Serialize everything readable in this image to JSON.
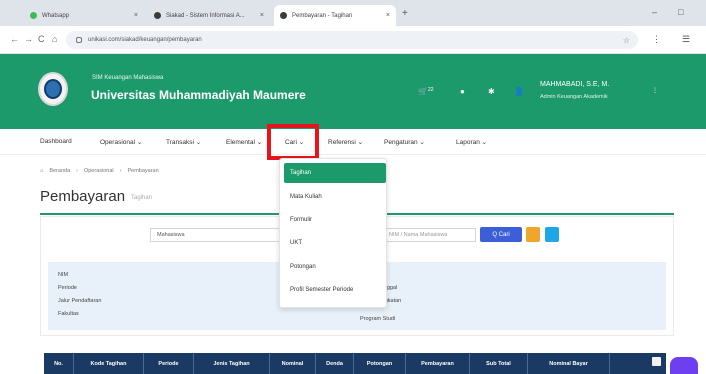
{
  "browser": {
    "tabs": [
      {
        "label": "Whatsapp",
        "close": "×",
        "favicon_color": "#3cbc5a"
      },
      {
        "label": "Siakad - Sistem Informasi A...",
        "close": "×",
        "favicon_color": "#3a3a3a"
      },
      {
        "label": "Pembayaran - Tagihan",
        "close": "×",
        "favicon_color": "#3a3a3a"
      }
    ],
    "new_tab": "+",
    "window_controls": [
      "–",
      "□"
    ],
    "nav": {
      "back": "←",
      "forward": "→",
      "reload": "C",
      "home": "⌂"
    },
    "url": "unikasi.com/siakad/keuangan/pembayaran",
    "omni_right": [
      "☆",
      "⋮"
    ],
    "extensions": [
      "⋮",
      "☰"
    ]
  },
  "header": {
    "subtitle": "SIM Keuangan Mahasiswa",
    "title": "Universitas Muhammadiyah Maumere",
    "icons": {
      "cart": "🛒",
      "cart_badge": "22",
      "bell": "●",
      "settings": "✱",
      "person": "👤"
    },
    "user": {
      "name": "MAHMABADI, S.E, M.",
      "role": "Admin Keuangan Akademik",
      "caret": "⋮"
    }
  },
  "nav": {
    "items": [
      {
        "label": "Dashboard"
      },
      {
        "label": "Operasional ⌄"
      },
      {
        "label": "Transaksi ⌄"
      },
      {
        "label": "Elemental ⌄"
      },
      {
        "label": "Cari ⌄"
      },
      {
        "label": "Referensi ⌄"
      },
      {
        "label": "Pengaturan ⌄"
      },
      {
        "label": "Laporan ⌄"
      }
    ]
  },
  "dropdown": {
    "items": [
      {
        "label": "Tagihan",
        "active": true
      },
      {
        "label": "Mata Kuliah"
      },
      {
        "label": "Formulir"
      },
      {
        "label": "UKT"
      },
      {
        "label": "Potongan"
      },
      {
        "label": "Profil Semester Periode"
      }
    ]
  },
  "breadcrumb": {
    "items": [
      "Beranda",
      "Operasional",
      "Pembayaran"
    ],
    "separator": "›"
  },
  "page": {
    "title": "Pembayaran",
    "subtitle": "Tagihan"
  },
  "filter": {
    "select_value": "Mahasiswa",
    "search_placeholder": "NIM / Nama Mahasiswa",
    "search_button": "Q Cari",
    "colors": {
      "primary": "#3c5fd8",
      "warning": "#f0a52c",
      "info": "#1ea6e8"
    }
  },
  "info": {
    "left_labels": [
      "NIM",
      "Periode",
      "Jalur Pendaftaran",
      "Fakultas"
    ],
    "right_labels": [
      "Tanggal",
      "Angkatan",
      "Program Studi"
    ]
  },
  "table": {
    "headers": [
      "No.",
      "Kode Tagihan",
      "Periode",
      "Jenis Tagihan",
      "Nominal",
      "Denda",
      "Potongan",
      "Pembayaran",
      "Sub Total",
      "Nominal Bayar",
      ""
    ]
  },
  "colors": {
    "brand_green": "#1d9a6c",
    "table_header": "#1a3a63",
    "highlight_red": "#e8141b"
  }
}
